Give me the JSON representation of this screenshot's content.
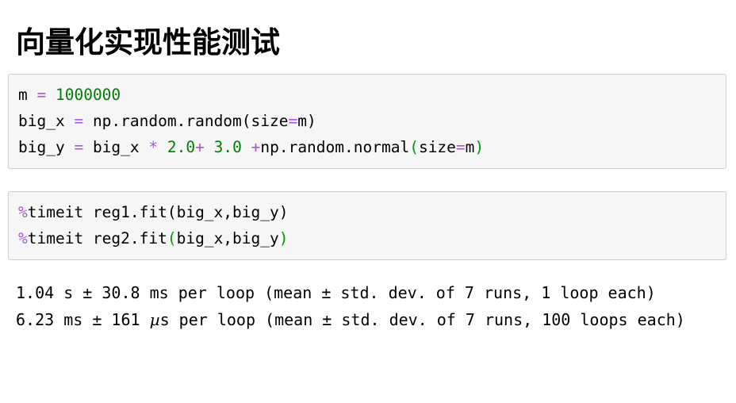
{
  "title": "向量化实现性能测试",
  "code_cells": [
    {
      "name": "data-setup-cell",
      "lines": [
        [
          {
            "t": "m ",
            "c": "plain"
          },
          {
            "t": "=",
            "c": "op"
          },
          {
            "t": " ",
            "c": "plain"
          },
          {
            "t": "1000000",
            "c": "num"
          }
        ],
        [
          {
            "t": "big_x ",
            "c": "plain"
          },
          {
            "t": "=",
            "c": "op"
          },
          {
            "t": " np.random.random(size",
            "c": "plain"
          },
          {
            "t": "=",
            "c": "op"
          },
          {
            "t": "m)",
            "c": "plain"
          }
        ],
        [
          {
            "t": "big_y ",
            "c": "plain"
          },
          {
            "t": "=",
            "c": "op"
          },
          {
            "t": " big_x ",
            "c": "plain"
          },
          {
            "t": "*",
            "c": "op"
          },
          {
            "t": " ",
            "c": "plain"
          },
          {
            "t": "2.0",
            "c": "num"
          },
          {
            "t": "+",
            "c": "op"
          },
          {
            "t": " ",
            "c": "plain"
          },
          {
            "t": "3.0",
            "c": "num"
          },
          {
            "t": " ",
            "c": "plain"
          },
          {
            "t": "+",
            "c": "op"
          },
          {
            "t": "np.random.normal",
            "c": "plain"
          },
          {
            "t": "(",
            "c": "grn"
          },
          {
            "t": "size",
            "c": "plain"
          },
          {
            "t": "=",
            "c": "op"
          },
          {
            "t": "m",
            "c": "plain"
          },
          {
            "t": ")",
            "c": "grn"
          }
        ]
      ],
      "plain_text": "m = 1000000\nbig_x = np.random.random(size=m)\nbig_y = big_x * 2.0+ 3.0 +np.random.normal(size=m)"
    },
    {
      "name": "timeit-cell",
      "lines": [
        [
          {
            "t": "%",
            "c": "magic"
          },
          {
            "t": "timeit reg1.fit(big_x,big_y)",
            "c": "plain"
          }
        ],
        [
          {
            "t": "%",
            "c": "magic"
          },
          {
            "t": "timeit reg2.fit",
            "c": "plain"
          },
          {
            "t": "(",
            "c": "grn"
          },
          {
            "t": "big_x,big_y",
            "c": "plain"
          },
          {
            "t": ")",
            "c": "grn"
          }
        ]
      ],
      "plain_text": "%timeit reg1.fit(big_x,big_y)\n%timeit reg2.fit(big_x,big_y)"
    }
  ],
  "output": {
    "name": "timeit-output",
    "lines": [
      "1.04 s ± 30.8 ms per loop (mean ± std. dev. of 7 runs, 1 loop each)",
      "6.23 ms ± 161 µs per loop (mean ± std. dev. of 7 runs, 100 loops each)"
    ],
    "results": [
      {
        "label": "reg1.fit",
        "mean": "1.04 s",
        "std": "30.8 ms",
        "runs": 7,
        "loops_each": 1
      },
      {
        "label": "reg2.fit",
        "mean": "6.23 ms",
        "std": "161 µs",
        "runs": 7,
        "loops_each": 100
      }
    ]
  },
  "colors": {
    "code_background": "#f6f6f6",
    "code_border": "#cfcfcf",
    "operator_purple": "#aa54d6",
    "number_green": "#007f00",
    "paren_green": "#009900",
    "text_black": "#000000",
    "page_background": "#ffffff"
  }
}
